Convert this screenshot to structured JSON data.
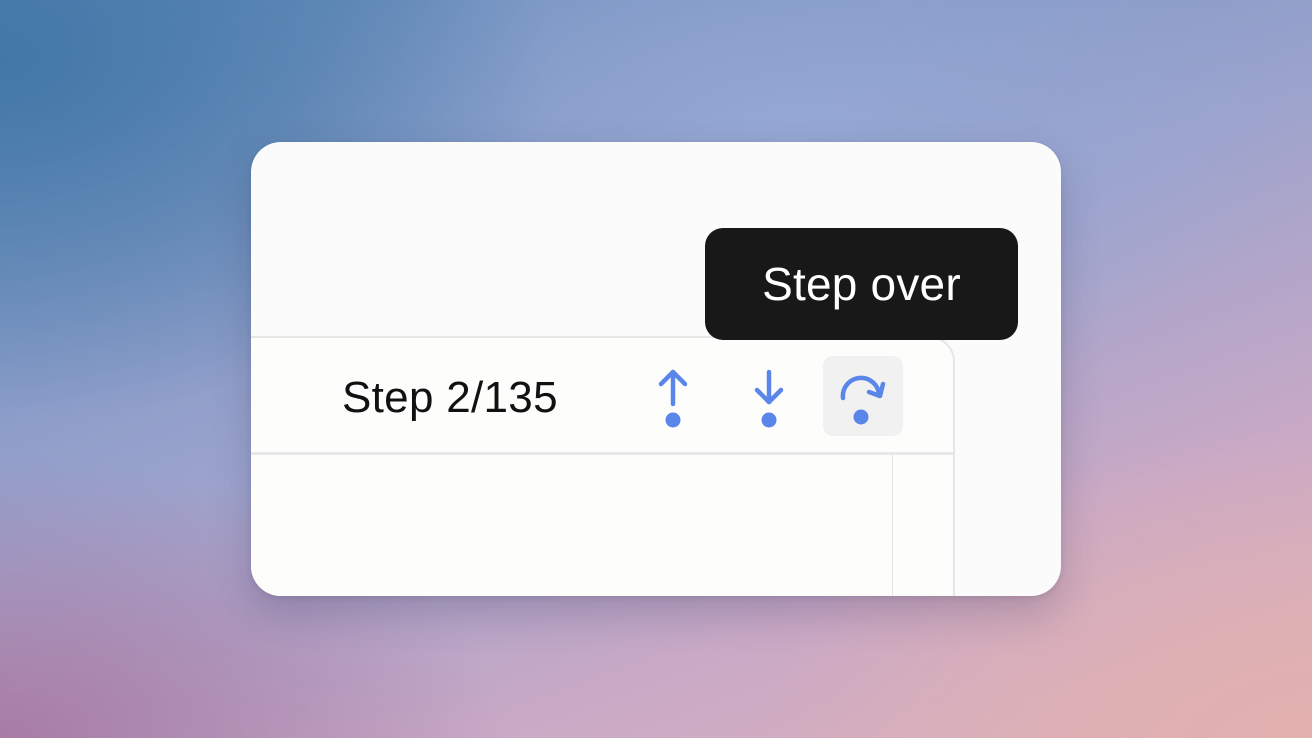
{
  "stepper": {
    "label": "Step 2/135"
  },
  "controls": {
    "step_back": {
      "icon": "arrow-up-dot-icon"
    },
    "step_forward": {
      "icon": "arrow-down-dot-icon"
    },
    "step_over": {
      "icon": "step-over-icon"
    }
  },
  "tooltip": {
    "text": "Step over"
  },
  "colors": {
    "accent": "#5a86ea",
    "tooltip_bg": "#181818",
    "active_button_bg": "#f1f1f1"
  }
}
